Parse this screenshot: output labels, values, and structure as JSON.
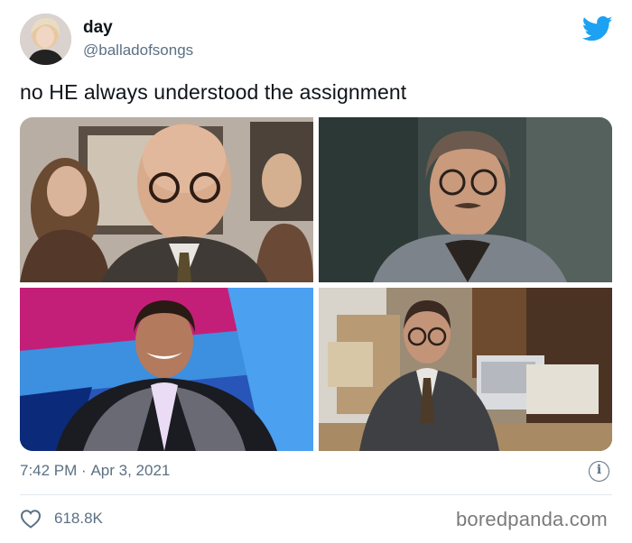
{
  "author": {
    "display_name": "day",
    "handle": "@balladofsongs"
  },
  "tweet": {
    "text": "no HE always understood the assignment",
    "time": "7:42 PM",
    "separator": "·",
    "date": "Apr 3, 2021",
    "likes": "618.8K"
  },
  "media": [
    {
      "alt": "man with glasses and bald head in office setting"
    },
    {
      "alt": "man with glasses smiling outdoors in coat"
    },
    {
      "alt": "man in sparkly suit smiling on stage"
    },
    {
      "alt": "man in suit at cluttered office desk"
    }
  ],
  "icons": {
    "brand": "twitter-bird-icon",
    "info": "info-icon",
    "like": "heart-icon"
  },
  "colors": {
    "brand_blue": "#1da1f2",
    "secondary_text": "#5b7083",
    "primary_text": "#0f1419"
  },
  "watermark": "boredpanda.com"
}
